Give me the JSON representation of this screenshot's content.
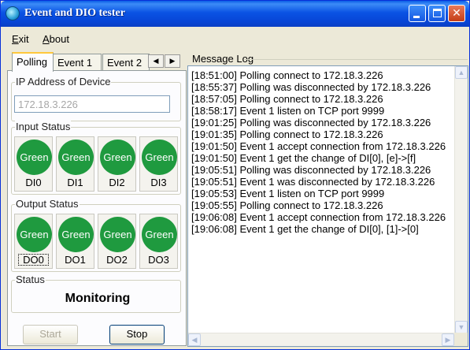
{
  "window": {
    "title": "Event and DIO tester"
  },
  "menu": {
    "items": [
      "Exit",
      "About"
    ]
  },
  "tabs": [
    {
      "label": "Polling",
      "active": true
    },
    {
      "label": "Event 1",
      "active": false
    },
    {
      "label": "Event 2",
      "active": false
    }
  ],
  "ip_group": {
    "label": "IP Address of Device",
    "value": "172.18.3.226"
  },
  "input_status": {
    "label": "Input Status",
    "leds": [
      {
        "state": "Green",
        "name": "DI0"
      },
      {
        "state": "Green",
        "name": "DI1"
      },
      {
        "state": "Green",
        "name": "DI2"
      },
      {
        "state": "Green",
        "name": "DI3"
      }
    ]
  },
  "output_status": {
    "label": "Output Status",
    "leds": [
      {
        "state": "Green",
        "name": "DO0"
      },
      {
        "state": "Green",
        "name": "DO1"
      },
      {
        "state": "Green",
        "name": "DO2"
      },
      {
        "state": "Green",
        "name": "DO3"
      }
    ]
  },
  "status": {
    "label": "Status",
    "value": "Monitoring"
  },
  "buttons": {
    "start": "Start",
    "stop": "Stop"
  },
  "message_log": {
    "label": "Message Log",
    "lines": [
      "[18:51:00] Polling connect to 172.18.3.226",
      "[18:55:37] Polling was disconnected by 172.18.3.226",
      "[18:57:05] Polling connect to 172.18.3.226",
      "[18:58:17] Event 1 listen on TCP port 9999",
      "[19:01:25] Polling was disconnected by 172.18.3.226",
      "[19:01:35] Polling connect to 172.18.3.226",
      "[19:01:50] Event 1 accept connection from 172.18.3.226",
      "[19:01:50] Event 1 get the change of DI[0], [e]->[f]",
      "[19:05:51] Polling was disconnected by 172.18.3.226",
      "[19:05:51] Event 1 was disconnected by 172.18.3.226",
      "[19:05:53] Event 1 listen on TCP port 9999",
      "[19:05:55] Polling connect to 172.18.3.226",
      "[19:06:08] Event 1 accept connection from 172.18.3.226",
      "[19:06:08] Event 1 get the change of DI[0], [1]->[0]"
    ]
  },
  "colors": {
    "led_green": "#1f9a3f",
    "titlebar": "#0a53e4"
  }
}
